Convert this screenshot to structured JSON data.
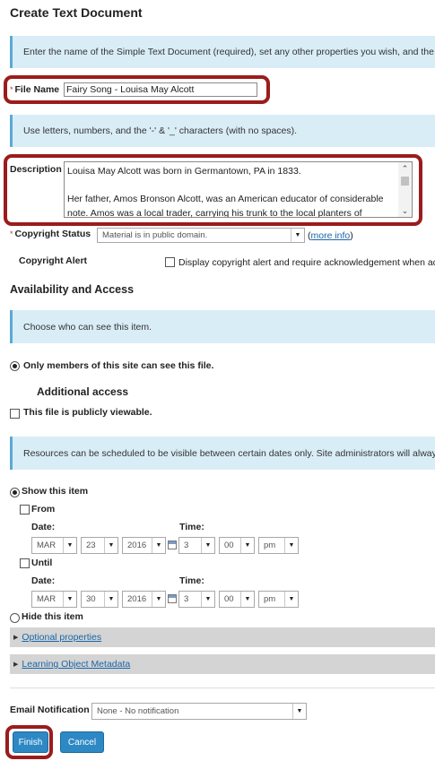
{
  "page": {
    "title": "Create Text Document"
  },
  "info1": "Enter the name of the Simple Text Document (required), set any other properties you wish, and the",
  "file_name": {
    "required_mark": "*",
    "label": "File Name",
    "value": "Fairy Song - Louisa May Alcott"
  },
  "info2": "Use letters, numbers, and the '-' & '_' characters (with no spaces).",
  "description": {
    "label": "Description",
    "paragraphs": [
      "Louisa May Alcott was born in Germantown, PA in 1833.",
      "Her father, Amos Bronson Alcott, was an American educator of considerable note. Amos was a local trader, carrying his trunk to the local planters of"
    ]
  },
  "copyright": {
    "required_mark": "*",
    "label": "Copyright Status",
    "selected": "Material is in public domain.",
    "more_info_open": "(",
    "more_info": "more info",
    "more_info_close": ")",
    "alert_label": "Copyright Alert",
    "alert_checkbox_label": "Display copyright alert and require acknowledgement when ac"
  },
  "availability": {
    "heading": "Availability and Access",
    "info": "Choose who can see this item.",
    "only_members": "Only members of this site can see this file.",
    "additional_heading": "Additional access",
    "public_label": "This file is publicly viewable.",
    "schedule_info": "Resources can be scheduled to be visible between certain dates only. Site administrators will alway",
    "show_item": "Show this item",
    "hide_item": "Hide this item",
    "from": {
      "label": "From",
      "date_label": "Date:",
      "time_label": "Time:",
      "month": "MAR",
      "day": "23",
      "year": "2016",
      "hour": "3",
      "minute": "00",
      "ampm": "pm"
    },
    "until": {
      "label": "Until",
      "date_label": "Date:",
      "time_label": "Time:",
      "month": "MAR",
      "day": "30",
      "year": "2016",
      "hour": "3",
      "minute": "00",
      "ampm": "pm"
    }
  },
  "collapsibles": {
    "optional": "Optional properties",
    "lom": "Learning Object Metadata"
  },
  "email": {
    "label": "Email Notification",
    "selected": "None - No notification"
  },
  "buttons": {
    "finish": "Finish",
    "cancel": "Cancel"
  },
  "colors": {
    "info_bg": "#d9edf7",
    "highlight": "#9b1c1c",
    "primary_button": "#2d88c4",
    "link": "#1a66a8"
  }
}
